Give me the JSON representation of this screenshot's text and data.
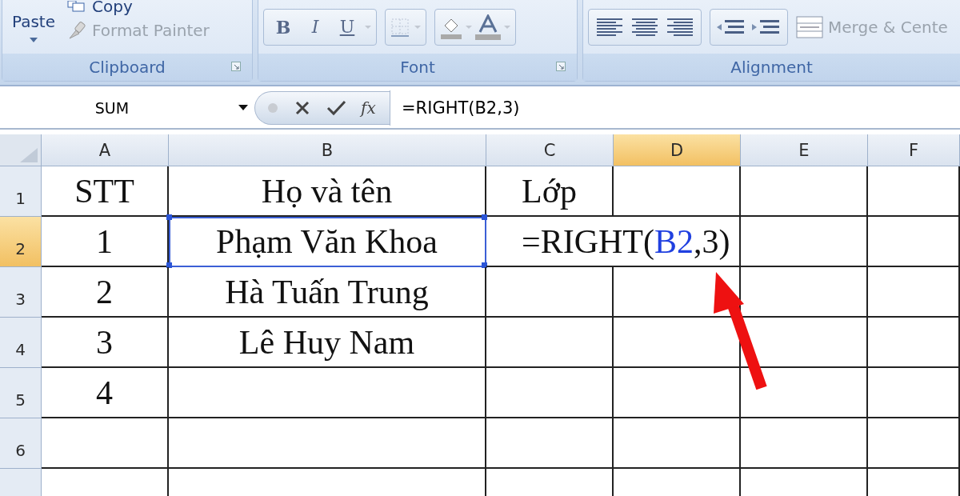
{
  "ribbon": {
    "clipboard": {
      "paste": "Paste",
      "copy": "Copy",
      "format_painter": "Format Painter",
      "label": "Clipboard"
    },
    "font": {
      "bold": "B",
      "italic": "I",
      "underline": "U",
      "label": "Font"
    },
    "alignment": {
      "merge": "Merge & Cente",
      "label": "Alignment"
    }
  },
  "formula_bar": {
    "name_box": "SUM",
    "fx": "fx",
    "value": "=RIGHT(B2,3)"
  },
  "columns": [
    {
      "label": "A",
      "selected": false
    },
    {
      "label": "B",
      "selected": false
    },
    {
      "label": "C",
      "selected": false
    },
    {
      "label": "D",
      "selected": true
    },
    {
      "label": "E",
      "selected": false
    },
    {
      "label": "F",
      "selected": false
    }
  ],
  "rows": [
    {
      "label": "1",
      "selected": false,
      "cells": [
        {
          "text": "STT",
          "selected": false
        },
        {
          "text": "Họ và tên",
          "selected": false
        },
        {
          "text": "Lớp",
          "selected": false
        }
      ]
    },
    {
      "label": "2",
      "selected": true,
      "cells": [
        {
          "text": "1",
          "selected": false
        },
        {
          "text": "Phạm Văn Khoa",
          "selected": true
        },
        {
          "kind": "formula",
          "selected": false,
          "parts": [
            {
              "kind": "plain",
              "text": "=RIGHT("
            },
            {
              "kind": "ref",
              "text": "B2"
            },
            {
              "kind": "plain",
              "text": ",3)"
            }
          ]
        }
      ]
    },
    {
      "label": "3",
      "selected": false,
      "cells": [
        {
          "text": "2",
          "selected": false
        },
        {
          "text": "Hà Tuấn Trung",
          "selected": false
        }
      ]
    },
    {
      "label": "4",
      "selected": false,
      "cells": [
        {
          "text": "3",
          "selected": false
        },
        {
          "text": "Lê Huy Nam",
          "selected": false
        }
      ]
    },
    {
      "label": "5",
      "selected": false,
      "cells": [
        {
          "text": "4",
          "selected": false
        }
      ]
    },
    {
      "label": "6",
      "selected": false,
      "cells": []
    }
  ]
}
